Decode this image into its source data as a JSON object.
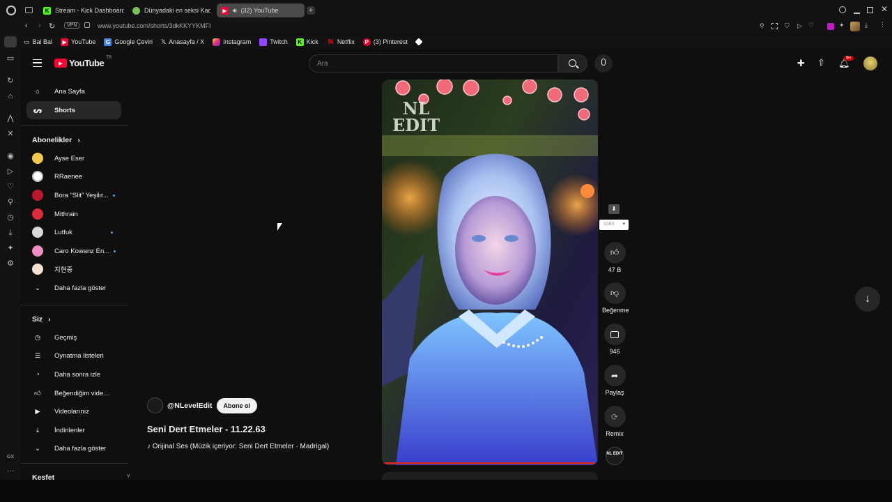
{
  "browser": {
    "tabs": [
      {
        "title": "Stream - Kick Dashboard",
        "favicon": "kick-icon"
      },
      {
        "title": "Dünyadaki en seksi Kadın",
        "favicon": "tab-leaf-icon"
      },
      {
        "title": "(32) YouTube",
        "favicon": "youtube-icon"
      }
    ],
    "vpn": "VPN",
    "url": "www.youtube.com/shorts/3dkKKYYKMFI",
    "bookmarks": [
      "Bal Bal",
      "YouTube",
      "Google Çeviri",
      "Anasayfa / X",
      "Instagram",
      "Twitch",
      "Kick",
      "Netflix",
      "(3) Pinterest"
    ],
    "side_label": "GX"
  },
  "header": {
    "logo_text": "YouTube",
    "logo_sup": "TR",
    "search_placeholder": "Ara",
    "notifications": "9+"
  },
  "sidebar": {
    "main": [
      {
        "label": "Ana Sayfa",
        "icon": "home-icon"
      },
      {
        "label": "Shorts",
        "icon": "shorts-icon"
      }
    ],
    "subscriptions_title": "Abonelikler",
    "subscriptions": [
      {
        "label": "Ayse Eser",
        "live": false,
        "color": "#f2c94c"
      },
      {
        "label": "RRaenee",
        "live": false,
        "color": "#ffffff"
      },
      {
        "label": "Bora “Slit” Yeşilır...",
        "live": true,
        "color": "#c0182b"
      },
      {
        "label": "Mithrain",
        "live": false,
        "color": "#e02b3c"
      },
      {
        "label": "Lutfuk",
        "live": true,
        "color": "#d9d9d9"
      },
      {
        "label": "Caro Kowanz En...",
        "live": true,
        "color": "#f08fc0"
      },
      {
        "label": "지현중",
        "live": false,
        "color": "#f4e1d2"
      }
    ],
    "subs_more": "Daha fazla göster",
    "you_title": "Siz",
    "you": [
      {
        "label": "Geçmiş",
        "icon": "history-icon"
      },
      {
        "label": "Oynatma listeleri",
        "icon": "playlist-icon"
      },
      {
        "label": "Daha sonra izle",
        "icon": "clock-icon"
      },
      {
        "label": "Beğendiğim videolar",
        "icon": "thumbs-up-icon"
      },
      {
        "label": "Videolarınız",
        "icon": "video-icon"
      },
      {
        "label": "İndirilenler",
        "icon": "download-icon"
      }
    ],
    "you_more": "Daha fazla göster",
    "explore_title": "Keşfet"
  },
  "short": {
    "watermark_line1": "NL",
    "watermark_line2": "EDIT",
    "channel": "@NLevelEdit",
    "subscribe": "Abone ol",
    "title": "Seni Dert Etmeler - 11.22.63",
    "music": "♪ Orijinal Ses (Müzik içeriyor: Seni Dert Etmeler · Madrigal)",
    "quality": "1080",
    "likes": "47 B",
    "dislike_label": "Beğenme",
    "comments": "946",
    "share_label": "Paylaş",
    "remix_label": "Remix",
    "channel_badge": "NL EDIT"
  }
}
